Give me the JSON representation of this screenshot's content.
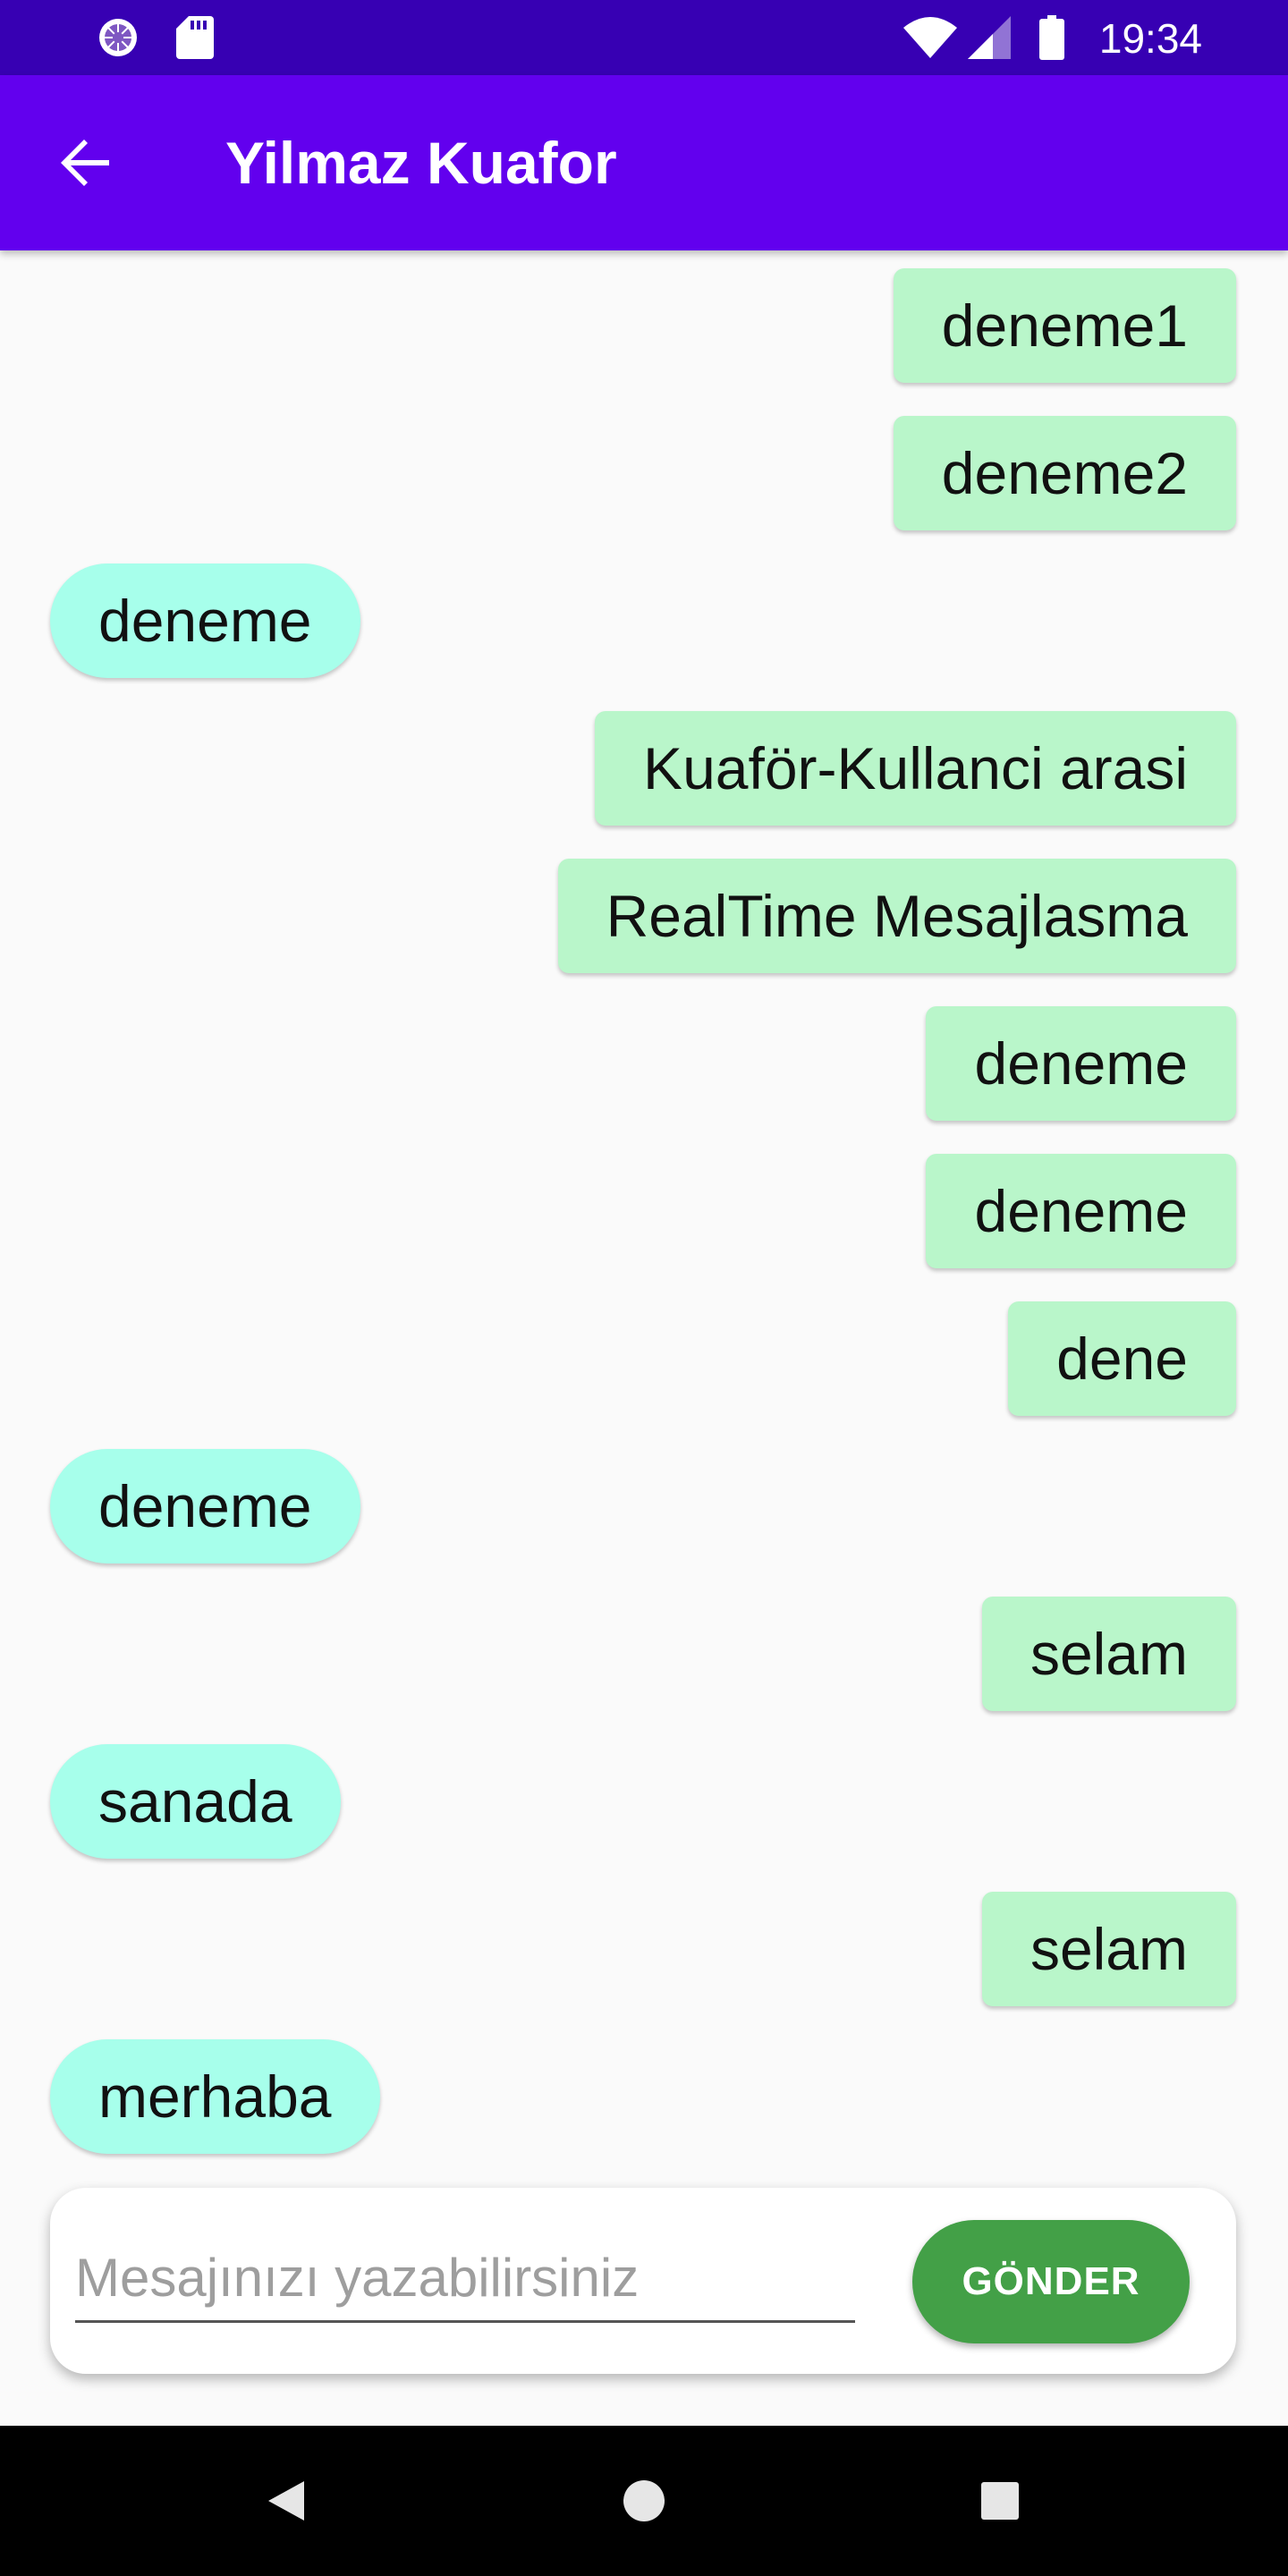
{
  "status_bar": {
    "time": "19:34",
    "icons": [
      "sync-circle-icon",
      "sd-card-icon",
      "wifi-icon",
      "signal-icon",
      "battery-icon"
    ]
  },
  "app_bar": {
    "title": "Yilmaz Kuafor",
    "back_icon": "arrow-back-icon"
  },
  "messages": [
    {
      "text": "deneme1",
      "side": "sent"
    },
    {
      "text": "deneme2",
      "side": "sent"
    },
    {
      "text": "deneme",
      "side": "received"
    },
    {
      "text": "Kuaför-Kullanci arasi",
      "side": "sent"
    },
    {
      "text": "RealTime Mesajlasma",
      "side": "sent"
    },
    {
      "text": "deneme",
      "side": "sent"
    },
    {
      "text": "deneme",
      "side": "sent"
    },
    {
      "text": "dene",
      "side": "sent"
    },
    {
      "text": "deneme",
      "side": "received"
    },
    {
      "text": "selam",
      "side": "sent"
    },
    {
      "text": "sanada",
      "side": "received"
    },
    {
      "text": "selam",
      "side": "sent"
    },
    {
      "text": "merhaba",
      "side": "received"
    }
  ],
  "composer": {
    "placeholder": "Mesajınızı yazabilirsiniz",
    "value": "",
    "send_label": "GÖNDER"
  },
  "nav_bar": {
    "icons": [
      "back-triangle-icon",
      "home-circle-icon",
      "recents-square-icon"
    ]
  },
  "colors": {
    "status_bar": "#3700b3",
    "app_bar": "#6200ee",
    "sent_bubble": "#b9f6ca",
    "received_bubble": "#a7ffeb",
    "send_button": "#43a047",
    "background": "#fafafa"
  }
}
